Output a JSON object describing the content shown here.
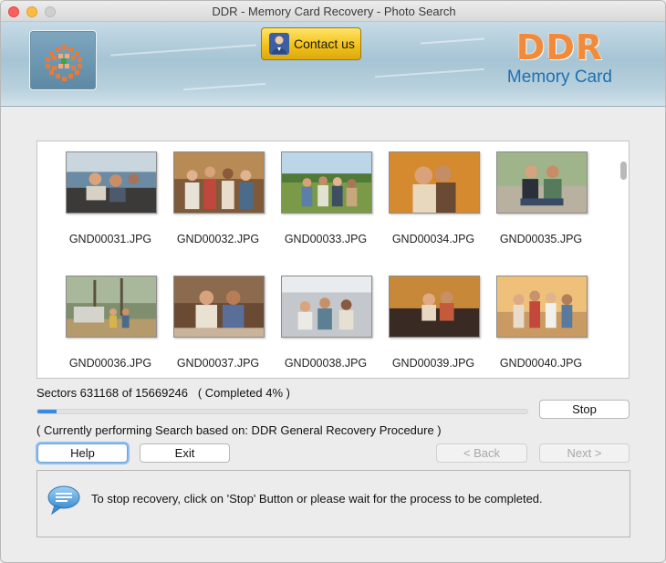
{
  "window": {
    "title": "DDR - Memory Card Recovery - Photo Search"
  },
  "banner": {
    "contact_label": "Contact us",
    "brand_title": "DDR",
    "brand_subtitle": "Memory Card",
    "colors": {
      "brand_orange": "#f08a3c",
      "brand_blue": "#1f6fb0"
    }
  },
  "gallery": {
    "items": [
      {
        "filename": "GND00031.JPG",
        "icon": "photo-thumbnail"
      },
      {
        "filename": "GND00032.JPG",
        "icon": "photo-thumbnail"
      },
      {
        "filename": "GND00033.JPG",
        "icon": "photo-thumbnail"
      },
      {
        "filename": "GND00034.JPG",
        "icon": "photo-thumbnail"
      },
      {
        "filename": "GND00035.JPG",
        "icon": "photo-thumbnail"
      },
      {
        "filename": "GND00036.JPG",
        "icon": "photo-thumbnail"
      },
      {
        "filename": "GND00037.JPG",
        "icon": "photo-thumbnail"
      },
      {
        "filename": "GND00038.JPG",
        "icon": "photo-thumbnail"
      },
      {
        "filename": "GND00039.JPG",
        "icon": "photo-thumbnail"
      },
      {
        "filename": "GND00040.JPG",
        "icon": "photo-thumbnail"
      }
    ]
  },
  "progress": {
    "sectors_text": "Sectors 631168 of 15669246   ( Completed 4% )",
    "percent": 4,
    "stop_label": "Stop",
    "status_text": "( Currently performing Search based on: DDR General Recovery Procedure )"
  },
  "nav": {
    "help_label": "Help",
    "exit_label": "Exit",
    "back_label": "< Back",
    "next_label": "Next >"
  },
  "message": {
    "icon": "speech-bubble-icon",
    "text": "To stop recovery, click on 'Stop' Button or please wait for the process to be completed."
  }
}
